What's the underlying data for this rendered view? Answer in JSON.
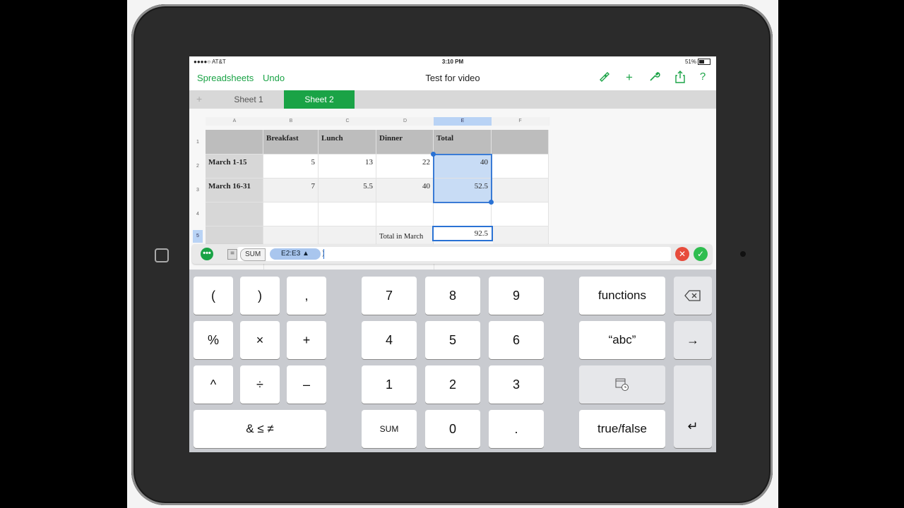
{
  "status": {
    "carrier": "●●●●○ AT&T",
    "time": "3:10 PM",
    "battery": "51%"
  },
  "toolbar": {
    "spreadsheets": "Spreadsheets",
    "undo": "Undo",
    "title": "Test for video",
    "icons": [
      "brush-icon",
      "plus-icon",
      "wrench-icon",
      "share-icon",
      "help-icon"
    ]
  },
  "tabs": [
    {
      "label": "Sheet 1",
      "active": false
    },
    {
      "label": "Sheet 2",
      "active": true
    }
  ],
  "table": {
    "columns": [
      "A",
      "B",
      "C",
      "D",
      "E",
      "F"
    ],
    "rows": [
      "1",
      "2",
      "3",
      "4",
      "5"
    ],
    "headers": [
      "Breakfast",
      "Lunch",
      "Dinner",
      "Total"
    ],
    "row2": {
      "label": "March 1-15",
      "b": "5",
      "c": "13",
      "d": "22",
      "e": "40"
    },
    "row3": {
      "label": "March 16-31",
      "b": "7",
      "c": "5.5",
      "d": "40",
      "e": "52.5"
    },
    "row5": {
      "label": "Total in March",
      "e": "92.5"
    }
  },
  "formula": {
    "function": "SUM",
    "range": "E2:E3 ▲",
    "close": ")"
  },
  "keypad": {
    "left": [
      "(",
      ")",
      ",",
      "%",
      "×",
      "+",
      "^",
      "÷",
      "–",
      "& ≤ ≠"
    ],
    "digits": [
      "7",
      "8",
      "9",
      "4",
      "5",
      "6",
      "1",
      "2",
      "3",
      "SUM",
      "0",
      "."
    ],
    "right": [
      "functions",
      "“abc”",
      "true/false"
    ],
    "icons": [
      "backspace-icon",
      "arrow-right-icon",
      "date-duration-icon",
      "return-icon"
    ]
  },
  "colors": {
    "accent": "#1aa346",
    "selection": "#3a7bd5"
  }
}
